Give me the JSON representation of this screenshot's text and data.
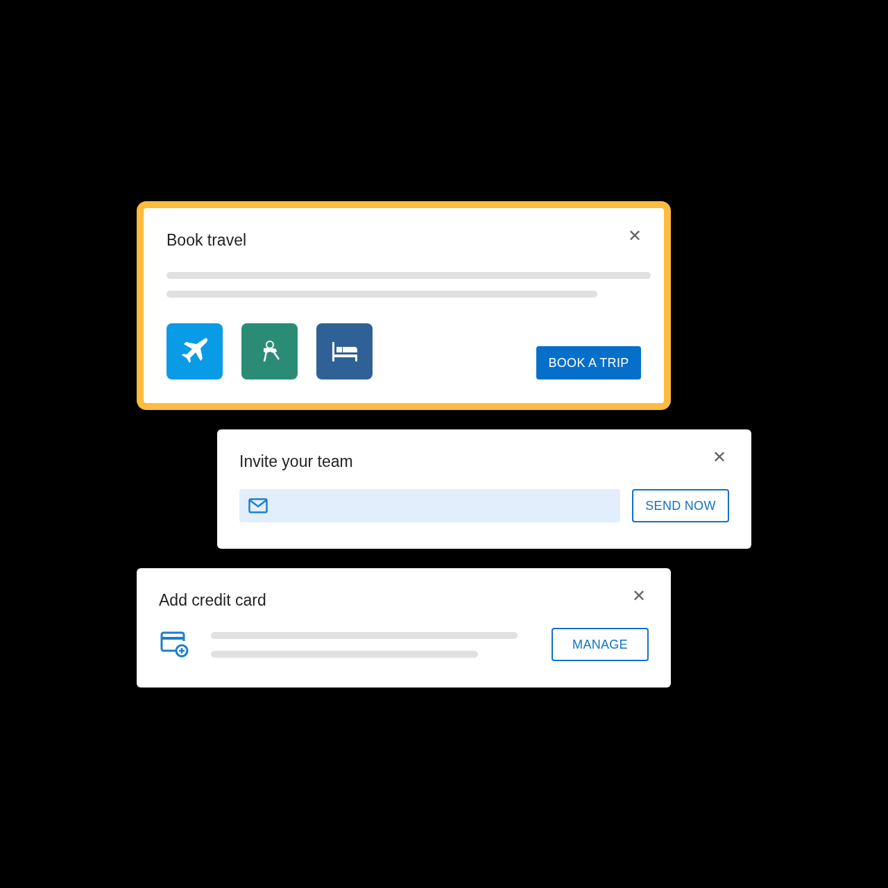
{
  "cards": [
    {
      "kind": "travel",
      "title": "Book travel",
      "highlighted": true,
      "close": "✕",
      "options": [
        {
          "kind": "flight",
          "color": "#0a9be6"
        },
        {
          "kind": "keys",
          "color": "#2b8c76"
        },
        {
          "kind": "bed",
          "color": "#2f6196"
        }
      ],
      "button": {
        "label": "BOOK A TRIP",
        "filled": true
      }
    },
    {
      "kind": "invite",
      "title": "Invite your team",
      "highlighted": false,
      "close": "✕",
      "button": {
        "label": "SEND NOW",
        "filled": false
      }
    },
    {
      "kind": "payment",
      "title": "Add credit card",
      "highlighted": false,
      "close": "✕",
      "button": {
        "label": "MANAGE",
        "filled": false
      }
    }
  ]
}
